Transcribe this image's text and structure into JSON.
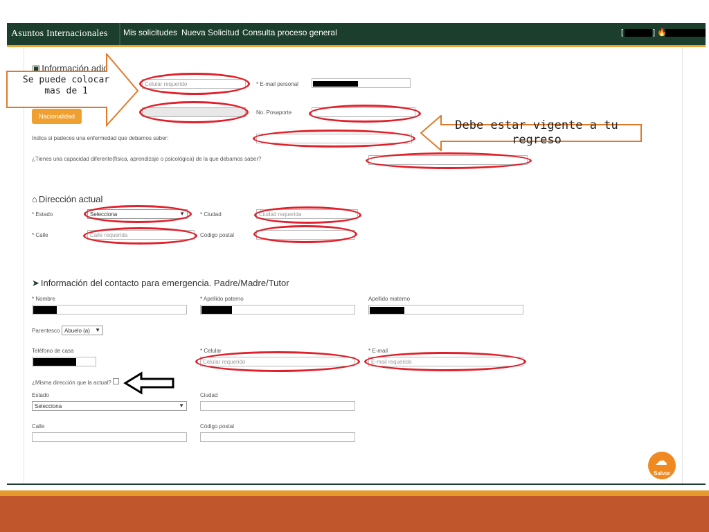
{
  "navbar": {
    "brand": "Asuntos Internacionales",
    "links": [
      "Mis solicitudes",
      "Nueva Solicitud",
      "Consulta proceso general"
    ],
    "user_bracket_open": "[",
    "user_bracket_close": "]",
    "fire_icon": "fire-icon"
  },
  "info_adicional": {
    "title": "Información adicional",
    "title_visible": "Información adici",
    "celular_placeholder": "Celular requerido",
    "email_label": "* E-mail personal",
    "nacionalidad_button": "Nacionalidad",
    "pasaporte_label": "No. Posaporte",
    "enfermedad_label": "Indica si padeces una enfermedad que debamos saber:",
    "capacidad_label": "¿Tienes una capacidad diferente(física, aprendizaje o psicológica) de la que debamos saber?"
  },
  "direccion_actual": {
    "title": "Dirección actual",
    "estado_label": "* Estado",
    "estado_value": "Selecciona",
    "ciudad_label": "* Ciudad",
    "ciudad_placeholder": "Ciudad requerida",
    "calle_label": "* Calle",
    "calle_placeholder": "Calle requerida",
    "cp_label": "Código postal"
  },
  "contacto_emergencia": {
    "title": "Información del contacto para emergencia. Padre/Madre/Tutor",
    "nombre_label": "* Nombre",
    "apellido_paterno_label": "* Apellido paterno",
    "apellido_materno_label": "Apellido materno",
    "parentesco_label": "Parentesco",
    "parentesco_value": "Abuelo (a)",
    "telefono_label": "Teléfono de casa",
    "celular_label": "* Celular",
    "celular_placeholder": "Celular requerido",
    "email_label": "* E-mail",
    "email_placeholder": "E-mail requerido",
    "misma_direccion_label": "¿Misma dirección que la actual?",
    "estado_label": "Estado",
    "estado_value": "Selecciona",
    "ciudad_label": "Ciudad",
    "calle_label": "Calle",
    "cp_label": "Código postal"
  },
  "save_button": "Salvar",
  "annotations": {
    "left_callout": "Se puede colocar mas de 1",
    "right_callout": "Debe estar vigente a tu regreso"
  },
  "colors": {
    "navbar": "#1c3e2c",
    "accent": "#f0a030",
    "highlight": "#e0202a",
    "footer": "#c0562c"
  }
}
